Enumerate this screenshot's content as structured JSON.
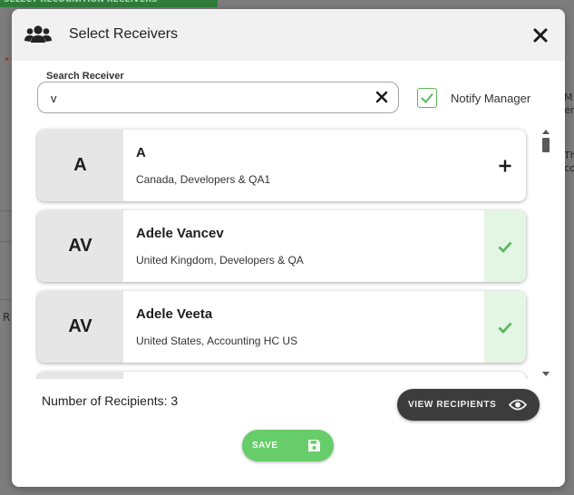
{
  "background": {
    "top_button_label": "SELECT RECOGNITION RECEIVERS",
    "top_button_icon": "plus-icon",
    "right_text_lines": [
      "M",
      "er",
      "Th",
      "co"
    ],
    "left_text": "R"
  },
  "modal": {
    "title": "Select Receivers",
    "header_icon": "users-icon",
    "close_icon": "close-icon"
  },
  "search": {
    "label": "Search Receiver",
    "value": "v",
    "placeholder": "",
    "clear_icon": "clear-icon"
  },
  "notify": {
    "label": "Notify Manager",
    "checked": true
  },
  "receivers": [
    {
      "initials": "A",
      "name": "A",
      "country": "Canada",
      "department": "Developers & QA1",
      "separator": ",",
      "selected": false,
      "action_icon": "plus-icon"
    },
    {
      "initials": "AV",
      "name": "Adele Vancev",
      "country": "United Kingdom",
      "department": "Developers & QA",
      "separator": ",",
      "selected": true,
      "action_icon": "check-icon"
    },
    {
      "initials": "AV",
      "name": "Adele Veeta",
      "country": "United States",
      "department": "Accounting HC US",
      "separator": ",",
      "selected": true,
      "action_icon": "check-icon"
    }
  ],
  "footer": {
    "recipients_label": "Number of Recipients: 3",
    "view_button_label": "VIEW RECIPIENTS",
    "view_icon": "eye-icon",
    "save_button_label": "SAVE",
    "save_icon": "floppy-disk-icon"
  },
  "colors": {
    "accent_green": "#67cd6b",
    "check_green": "#5cb85c",
    "selected_bg": "#e3f5e3",
    "dark_button": "#3c3c3c"
  }
}
